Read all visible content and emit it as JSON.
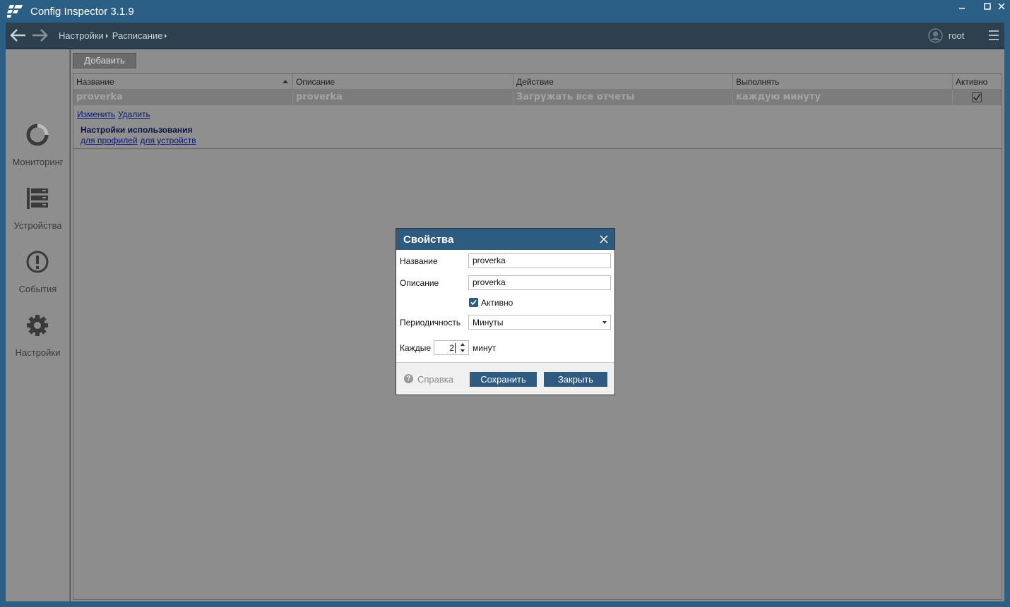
{
  "window": {
    "title": "Config Inspector 3.1.9"
  },
  "nav": {
    "breadcrumbs": [
      "Настройки",
      "Расписание"
    ],
    "user": "root"
  },
  "sidebar": {
    "items": [
      {
        "label": "Мониторинг",
        "icon": "monitoring-icon"
      },
      {
        "label": "Устройства",
        "icon": "devices-icon"
      },
      {
        "label": "События",
        "icon": "events-icon"
      },
      {
        "label": "Настройки",
        "icon": "settings-icon"
      }
    ]
  },
  "toolbar": {
    "add_label": "Добавить"
  },
  "table": {
    "columns": [
      "Название",
      "Описание",
      "Действие",
      "Выполнять",
      "Активно"
    ],
    "rows": [
      {
        "name": "proverka",
        "description": "proverka",
        "action": "Загружать все отчеты",
        "schedule": "каждую минуту",
        "active": true
      }
    ],
    "detail": {
      "edit": "Изменить",
      "delete": "Удалить",
      "usage_header": "Настройки использования",
      "for_profiles": "для профилей",
      "for_devices": "для устройств"
    }
  },
  "dialog": {
    "title": "Свойства",
    "name_label": "Название",
    "name_value": "proverka",
    "description_label": "Описание",
    "description_value": "proverka",
    "active_label": "Активно",
    "active_checked": true,
    "period_label": "Периодичность",
    "period_value": "Минуты",
    "every_label": "Каждые",
    "every_value": "2",
    "every_unit": "минут",
    "help_label": "Справка",
    "save_label": "Сохранить",
    "close_label": "Закрыть"
  },
  "colors": {
    "accent": "#2e5b80",
    "frame": "#2b5f86",
    "navbar": "#2e3f4d"
  }
}
